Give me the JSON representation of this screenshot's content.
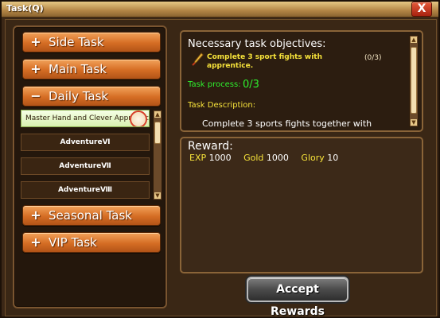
{
  "window": {
    "title": "Task(Q)",
    "close_label": "X"
  },
  "categories": [
    {
      "sign": "+",
      "label": "Side Task"
    },
    {
      "sign": "+",
      "label": "Main Task"
    },
    {
      "sign": "−",
      "label": "Daily Task"
    },
    {
      "sign": "+",
      "label": "Seasonal Task"
    },
    {
      "sign": "+",
      "label": "VIP Task"
    }
  ],
  "daily_tasks": [
    {
      "label": "Master Hand and Clever Apprentice",
      "selected": true
    },
    {
      "label": "AdventureⅥ",
      "selected": false
    },
    {
      "label": "AdventureⅦ",
      "selected": false
    },
    {
      "label": "AdventureⅧ",
      "selected": false
    }
  ],
  "objective": {
    "heading": "Necessary task objectives:",
    "items": [
      {
        "text": "Complete 3 sport fights with apprentice.",
        "progress": "(0/3)"
      }
    ],
    "process_label": "Task process:",
    "process_value": "0/3",
    "description_label": "Task Description:",
    "description_text": "Complete 3 sports fights together with"
  },
  "reward": {
    "heading": "Reward:",
    "items": [
      {
        "key": "EXP",
        "value": "1000"
      },
      {
        "key": "Gold",
        "value": "1000"
      },
      {
        "key": "Glory",
        "value": "10"
      }
    ]
  },
  "accept_label": "Accept Rewards",
  "icons": {
    "objective": "quill-icon",
    "badge": "seal-badge-icon"
  }
}
